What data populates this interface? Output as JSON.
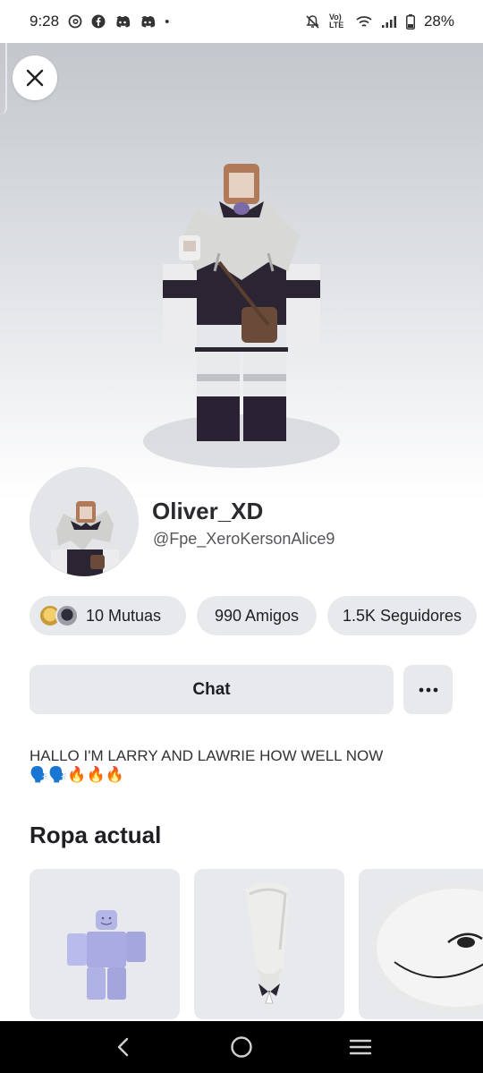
{
  "status_bar": {
    "time": "9:28",
    "dot": "•",
    "battery": "28%",
    "icons": [
      "threads-icon",
      "facebook-icon",
      "discord-icon",
      "discord-icon",
      "mute-icon",
      "volte-icon",
      "wifi-icon",
      "signal-icon",
      "battery-icon"
    ],
    "volte_label": "Vo) LTE"
  },
  "hero": {
    "close_icon": "close-icon"
  },
  "profile": {
    "display_name": "Oliver_XD",
    "username": "@Fpe_XeroKersonAlice9"
  },
  "stats": {
    "mutuals": "10 Mutuas",
    "friends": "990 Amigos",
    "followers": "1.5K Seguidores"
  },
  "actions": {
    "chat": "Chat",
    "more_icon": "more-horizontal-icon"
  },
  "bio": {
    "text": "HALLO I'M LARRY AND LAWRIE HOW WELL NOW",
    "emoji": "🗣️🗣️🔥🔥🔥"
  },
  "current_outfit": {
    "title": "Ropa actual",
    "items": [
      {
        "name": "avatar-body-item"
      },
      {
        "name": "hair-accessory-item"
      },
      {
        "name": "smile-head-item"
      }
    ]
  },
  "navbar": {
    "icons": [
      "back-icon",
      "home-icon",
      "recents-icon"
    ]
  },
  "colors": {
    "pill_bg": "#e8e9ec",
    "text": "#1e1f22",
    "hero_top": "#c3c7cc"
  }
}
